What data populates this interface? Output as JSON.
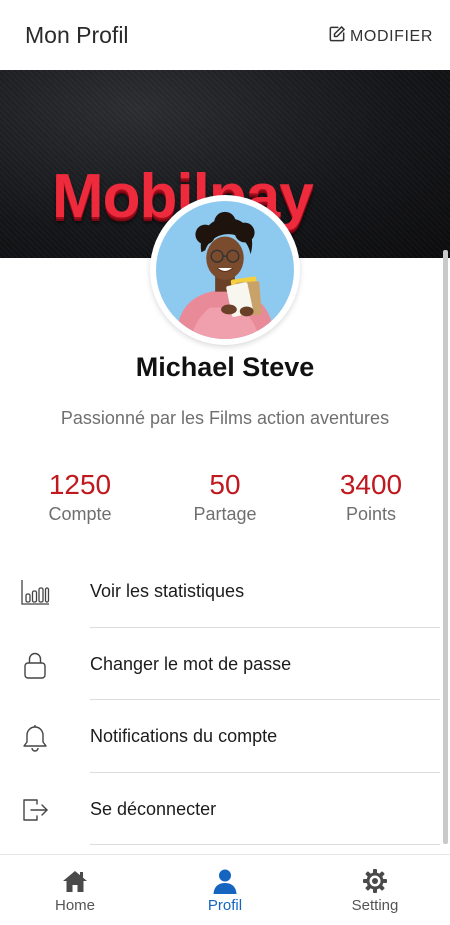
{
  "app_bar": {
    "title": "Mon Profil",
    "edit_label": "MODIFIER",
    "edit_icon": "edit-icon"
  },
  "banner": {
    "logo_text": "Mobilpay"
  },
  "profile": {
    "name": "Michael Steve",
    "bio": "Passionné par les Films action aventures"
  },
  "stats": [
    {
      "value": "1250",
      "label": "Compte"
    },
    {
      "value": "50",
      "label": "Partage"
    },
    {
      "value": "3400",
      "label": "Points"
    }
  ],
  "menu": [
    {
      "label": "Voir les statistiques",
      "icon": "bar-chart-icon"
    },
    {
      "label": "Changer le mot de passe",
      "icon": "lock-icon"
    },
    {
      "label": "Notifications du compte",
      "icon": "bell-icon"
    },
    {
      "label": "Se déconnecter",
      "icon": "logout-icon"
    }
  ],
  "bottom_nav": [
    {
      "label": "Home",
      "icon": "home-icon",
      "active": false
    },
    {
      "label": "Profil",
      "icon": "person-icon",
      "active": true
    },
    {
      "label": "Setting",
      "icon": "gear-icon",
      "active": false
    }
  ],
  "colors": {
    "accent": "#c0181f",
    "active_nav": "#1565c0",
    "brand_red": "#ee2a3d"
  }
}
